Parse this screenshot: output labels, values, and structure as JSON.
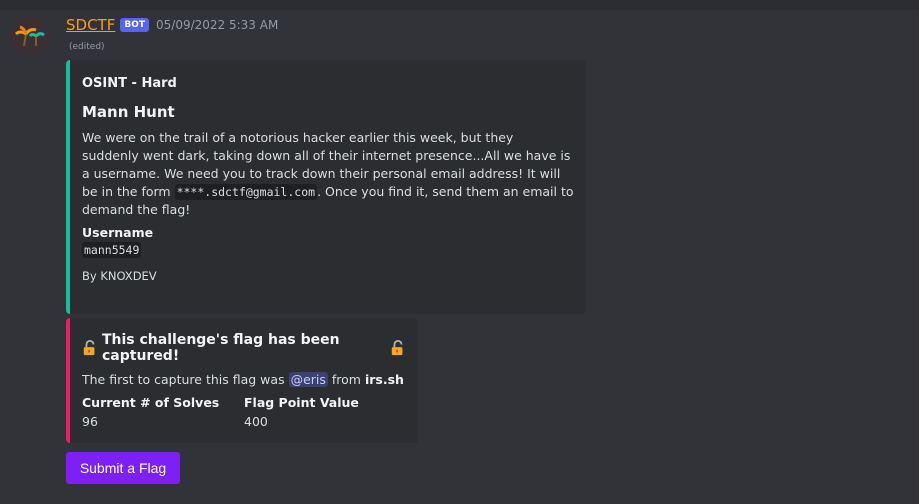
{
  "message": {
    "author": "SDCTF",
    "bot_tag": "BOT",
    "timestamp": "05/09/2022 5:33 AM",
    "edited": "(edited)"
  },
  "challenge_embed": {
    "accent_color": "#1abc9c",
    "category": "OSINT - Hard",
    "title": "Mann Hunt",
    "description_part1": "We were on the trail of a notorious hacker earlier this week, but they suddenly went dark, taking down all of their internet presence...All we have is a username. We need you to track down their personal email address! It will be in the form ",
    "description_code": "****.sdctf@gmail.com",
    "description_part2": ". Once you find it, send them an email to demand the flag!",
    "username_field_label": "Username",
    "username_field_value": "mann5549",
    "footer": "By KNOXDEV"
  },
  "flag_embed": {
    "accent_color": "#e91e63",
    "title": "This challenge's flag has been captured!",
    "first_capture_prefix": "The first to capture this flag was ",
    "first_capture_user": "@eris",
    "first_capture_mid": " from ",
    "first_capture_team": "irs.sh",
    "solves_label": "Current # of Solves",
    "solves_value": "96",
    "points_label": "Flag Point Value",
    "points_value": "400",
    "lock_icon": "unlocked-padlock-icon"
  },
  "submit_button": {
    "label": "Submit a Flag",
    "color": "#7d1ff7"
  }
}
